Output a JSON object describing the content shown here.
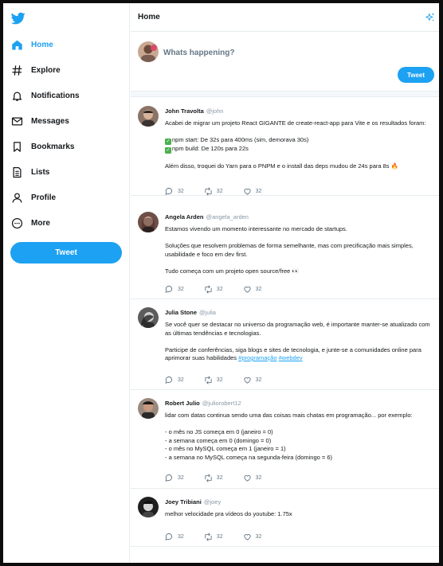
{
  "sidebar": {
    "logo": "twitter-bird-icon",
    "items": [
      {
        "label": "Home",
        "icon": "home-icon",
        "active": true
      },
      {
        "label": "Explore",
        "icon": "hashtag-icon"
      },
      {
        "label": "Notifications",
        "icon": "bell-icon"
      },
      {
        "label": "Messages",
        "icon": "mail-icon"
      },
      {
        "label": "Bookmarks",
        "icon": "bookmark-icon"
      },
      {
        "label": "Lists",
        "icon": "list-icon"
      },
      {
        "label": "Profile",
        "icon": "user-icon"
      },
      {
        "label": "More",
        "icon": "more-circle-icon"
      }
    ],
    "tweet_button": "Tweet"
  },
  "header": {
    "title": "Home",
    "icon": "sparkle-icon"
  },
  "composer": {
    "placeholder": "Whats happening?",
    "button": "Tweet"
  },
  "tweets": [
    {
      "name": "John Travolta",
      "handle": "@john",
      "lines": [
        "Acabei de migrar um projeto React GIGANTE de create-react-app para Vite e os resultados foram:",
        "",
        "npm start: De 32s para 400ms (sim, demorava 30s)",
        "npm build: De 120s para 22s",
        "",
        "Além disso, troquei do Yarn para o PNPM e o install das deps mudou de 24s para 8s 🔥"
      ],
      "comments": "32",
      "retweets": "32",
      "likes": "32"
    },
    {
      "name": "Angela Arden",
      "handle": "@angela_arden",
      "lines": [
        "Estamos vivendo um momento interessante no mercado de startups.",
        "",
        "Soluções que resolvem problemas de forma semelhante, mas com precificação mais simples, usabilidade e foco em dev first.",
        "",
        "Tudo começa com um projeto open source/free 👀"
      ],
      "comments": "32",
      "retweets": "32",
      "likes": "32"
    },
    {
      "name": "Julia Stone",
      "handle": "@julia",
      "lines": [
        "Se você quer se destacar no universo da programação web, é importante manter-se atualizado com as últimas tendências e tecnologias.",
        "",
        "Participe de conferências, siga blogs e sites de tecnologia, e junte-se a comunidades online para aprimorar suas habilidades"
      ],
      "hashtags": [
        "#programação",
        "#webdev"
      ],
      "comments": "32",
      "retweets": "32",
      "likes": "32"
    },
    {
      "name": "Robert Julio",
      "handle": "@juliorobert12",
      "lines": [
        "lidar com datas continua sendo uma das coisas mais chatas em programação... por exemplo:",
        "",
        "- o mês no JS começa em 0 (janeiro = 0)",
        "- a semana começa em 0 (domingo = 0)",
        "- o mês no MySQL começa em 1 (janeiro = 1)",
        "- a semana no MySQL começa na segunda-feira (domingo = 6)"
      ],
      "comments": "32",
      "retweets": "32",
      "likes": "32"
    },
    {
      "name": "Joey Tribiani",
      "handle": "@joey",
      "lines": [
        "melhor velocidade pra vídeos do youtube: 1.75x"
      ],
      "comments": "32",
      "retweets": "32",
      "likes": "32"
    }
  ],
  "colors": {
    "accent": "#1da1f2",
    "text": "#14171a",
    "muted": "#657786"
  }
}
